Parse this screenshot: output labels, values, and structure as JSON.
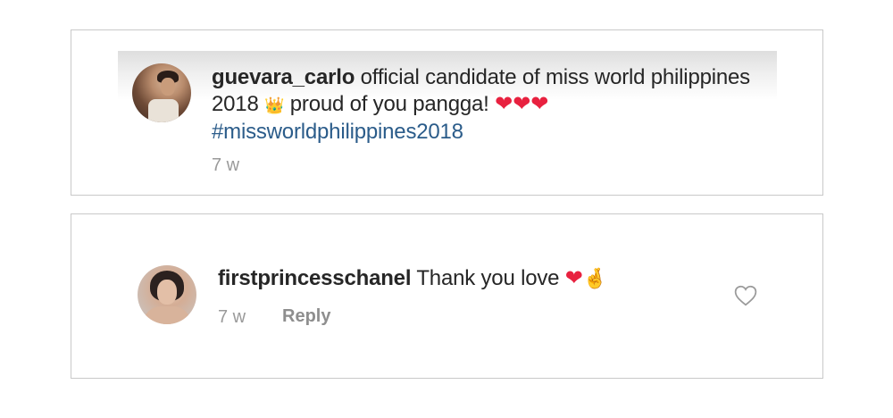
{
  "post": {
    "username": "guevara_carlo",
    "caption_part1": " official candidate of miss world philippines 2018 ",
    "crown_emoji": "👑",
    "caption_part2": " proud of you pangga! ",
    "hearts": "❤❤❤",
    "hashtag": "#missworldphilippines2018",
    "time": "7 w"
  },
  "comment": {
    "username": "firstprincesschanel",
    "text": " Thank you love ",
    "heart": "❤",
    "hand_emoji": "🤞",
    "time": "7 w",
    "reply_label": "Reply"
  },
  "icons": {
    "like": "heart-outline-icon"
  },
  "colors": {
    "hashtag": "#2b5c8a",
    "heart": "#e8213f",
    "muted": "#9a9a9a"
  }
}
